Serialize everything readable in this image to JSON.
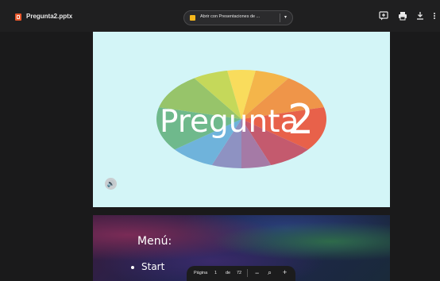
{
  "topbar": {
    "file_name": "Pregunta2.pptx",
    "open_with_label": "Abrir con Presentaciones de ...",
    "tools": [
      "add-comment-icon",
      "print-icon",
      "download-icon",
      "more-vert-icon"
    ]
  },
  "slides": [
    {
      "logo_text": "Pregunta",
      "logo_number": "2",
      "logo_colors": [
        "#f9dc5c",
        "#f4b54a",
        "#ef9549",
        "#e8614a",
        "#c45a6e",
        "#a57aa6",
        "#8e92c2",
        "#6fb3db",
        "#6fb98c",
        "#97c46a",
        "#c5d85a"
      ]
    },
    {
      "title": "Menú:",
      "items": [
        "Start"
      ]
    }
  ],
  "pager": {
    "page_label": "Página",
    "current_page": "1",
    "of_label": "de",
    "total_pages": "72",
    "zoom_out": "−",
    "zoom_in": "+"
  },
  "colors": {
    "background": "#1a1a1b",
    "slide_background": "#d3f5f7",
    "file_icon": "#e8562a",
    "open_with_icon": "#f5b71c"
  }
}
